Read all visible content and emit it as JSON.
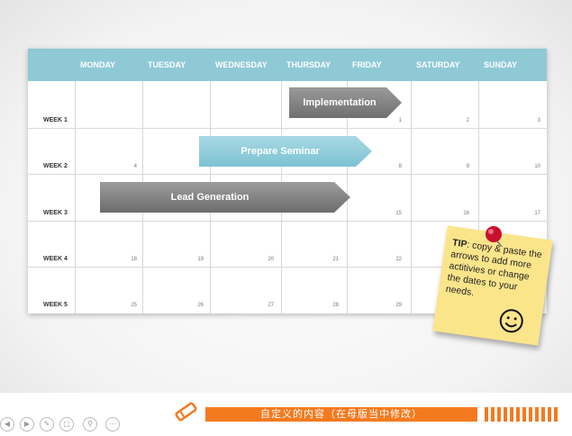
{
  "calendar": {
    "days": [
      "MONDAY",
      "TUESDAY",
      "WEDNESDAY",
      "THURSDAY",
      "FRIDAY",
      "SATURDAY",
      "SUNDAY"
    ],
    "weeks": [
      "WEEK 1",
      "WEEK 2",
      "WEEK 3",
      "WEEK 4",
      "WEEK 5"
    ],
    "dates": {
      "w1": [
        "1",
        "2",
        "3"
      ],
      "w2": [
        "4",
        "8",
        "9",
        "10"
      ],
      "w3": [
        "15",
        "16",
        "17"
      ],
      "w4": [
        "18",
        "19",
        "20",
        "21",
        "22"
      ],
      "w5": [
        "25",
        "26",
        "27",
        "28",
        "29"
      ]
    }
  },
  "arrows": {
    "implementation": "Implementation",
    "prepare_seminar": "Prepare Seminar",
    "lead_generation": "Lead Generation"
  },
  "note": {
    "tip_label": "TIP",
    "tip_text": ": copy & paste the arrows to add more actitivies or change the dates to your needs."
  },
  "footer": {
    "text": "自定义的内容（在母版当中修改）"
  },
  "colors": {
    "header": "#8fc9d6",
    "accent": "#f47a20",
    "note": "#fbe58b"
  }
}
